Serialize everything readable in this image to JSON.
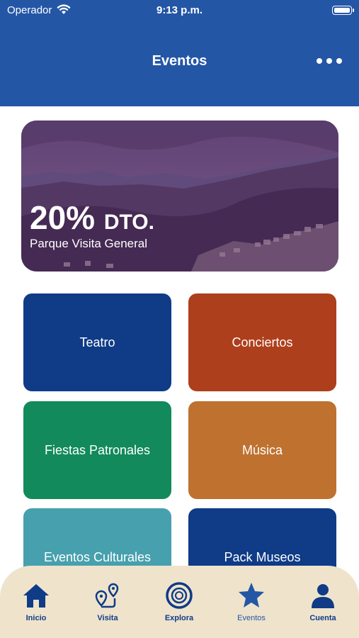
{
  "status_bar": {
    "carrier": "Operador",
    "time": "9:13 p.m."
  },
  "header": {
    "title": "Eventos",
    "more_icon": "more-dots-icon"
  },
  "promo": {
    "discount_value": "20%",
    "discount_suffix": "DTO.",
    "subtitle": "Parque Visita General"
  },
  "categories": [
    {
      "label": "Teatro",
      "color": "#0f3b87"
    },
    {
      "label": "Conciertos",
      "color": "#ae3f1c"
    },
    {
      "label": "Fiestas Patronales",
      "color": "#128a5b"
    },
    {
      "label": "Música",
      "color": "#bf7130"
    },
    {
      "label": "Eventos Culturales",
      "color": "#47a0ad"
    },
    {
      "label": "Pack Museos",
      "color": "#0f3b87"
    }
  ],
  "tabbar": {
    "items": [
      {
        "label": "Inicio",
        "icon": "home-icon"
      },
      {
        "label": "Visita",
        "icon": "route-pin-icon"
      },
      {
        "label": "Explora",
        "icon": "target-icon"
      },
      {
        "label": "Eventos",
        "icon": "star-icon",
        "active": true
      },
      {
        "label": "Cuenta",
        "icon": "user-icon"
      }
    ]
  },
  "colors": {
    "header": "#2456a6",
    "tabbar": "#efe3cc",
    "accent": "#0f3b87"
  }
}
